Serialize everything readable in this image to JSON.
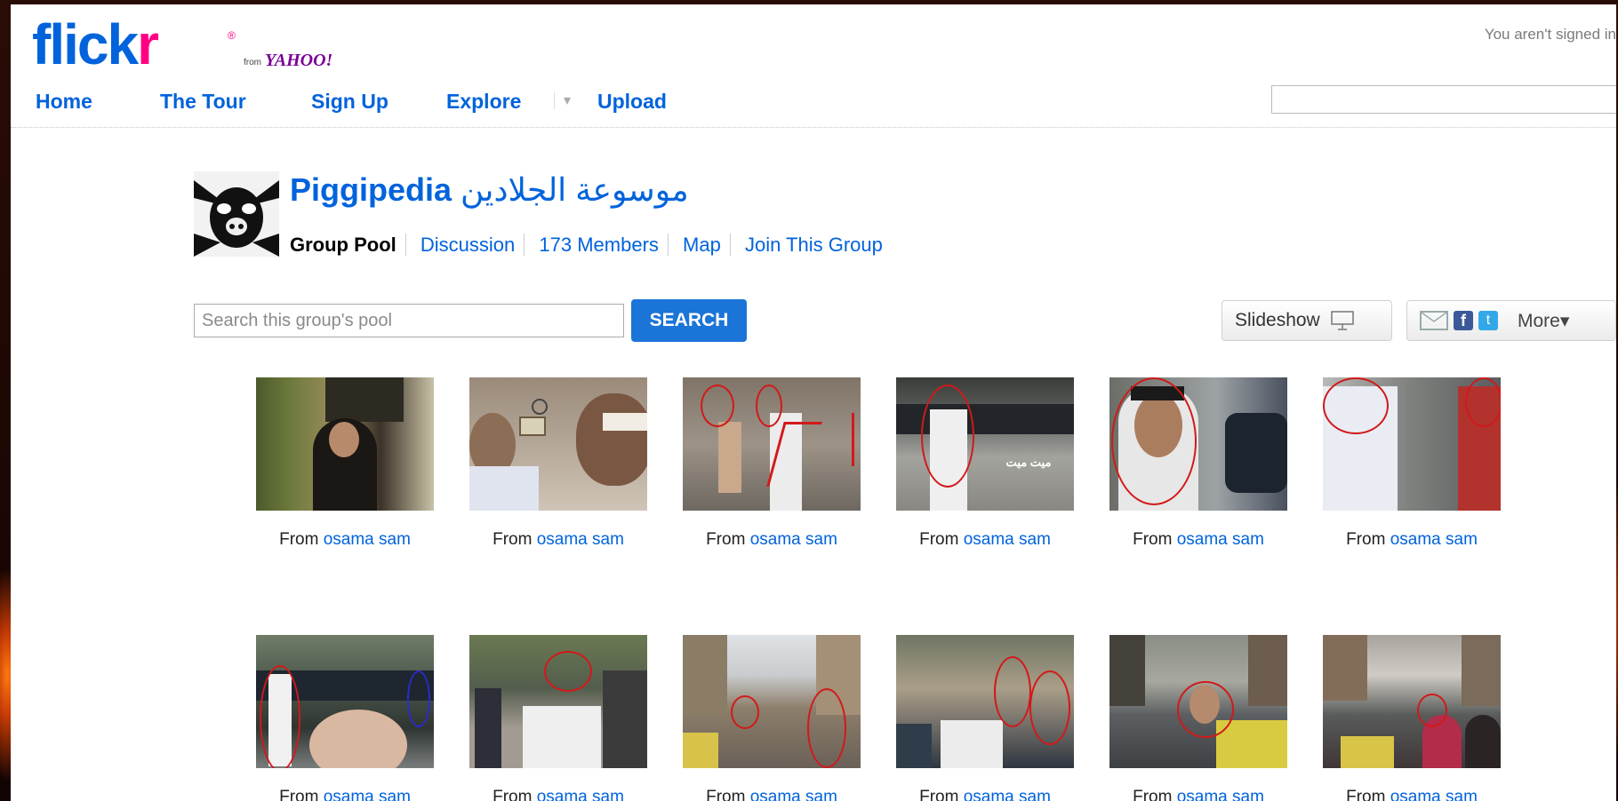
{
  "header": {
    "logo_text_a": "flick",
    "logo_text_b": "r",
    "logo_from": "from",
    "logo_yahoo": "YAHOO!",
    "signed_status": "You aren't signed in",
    "nav": [
      {
        "label": "Home"
      },
      {
        "label": "The Tour"
      },
      {
        "label": "Sign Up"
      },
      {
        "label": "Explore"
      },
      {
        "label": "Upload"
      }
    ]
  },
  "group": {
    "name": "Piggipedia",
    "name_arabic": "موسوعة الجلادين",
    "tabs": [
      {
        "label": "Group Pool"
      },
      {
        "label": "Discussion"
      },
      {
        "label": "173 Members"
      },
      {
        "label": "Map"
      },
      {
        "label": "Join This Group"
      }
    ]
  },
  "pool": {
    "search_placeholder": "Search this group's pool",
    "search_button": "SEARCH",
    "slideshow_label": "Slideshow",
    "share_more_label": "More▾",
    "icons": [
      "projector-icon",
      "email-icon",
      "facebook-icon",
      "twitter-icon"
    ]
  },
  "photos": [
    {
      "from": "From",
      "author": "osama sam"
    },
    {
      "from": "From",
      "author": "osama sam"
    },
    {
      "from": "From",
      "author": "osama sam"
    },
    {
      "from": "From",
      "author": "osama sam"
    },
    {
      "from": "From",
      "author": "osama sam"
    },
    {
      "from": "From",
      "author": "osama sam"
    },
    {
      "from": "From",
      "author": "osama sam"
    },
    {
      "from": "From",
      "author": "osama sam"
    },
    {
      "from": "From",
      "author": "osama sam"
    },
    {
      "from": "From",
      "author": "osama sam"
    },
    {
      "from": "From",
      "author": "osama sam"
    },
    {
      "from": "From",
      "author": "osama sam"
    }
  ],
  "photo4_overlay_text": "ميت ميت",
  "colors": {
    "link_blue": "#0063dc",
    "flickr_pink": "#ff0084",
    "search_button": "#1b74d8",
    "circle_red": "#d21919"
  }
}
